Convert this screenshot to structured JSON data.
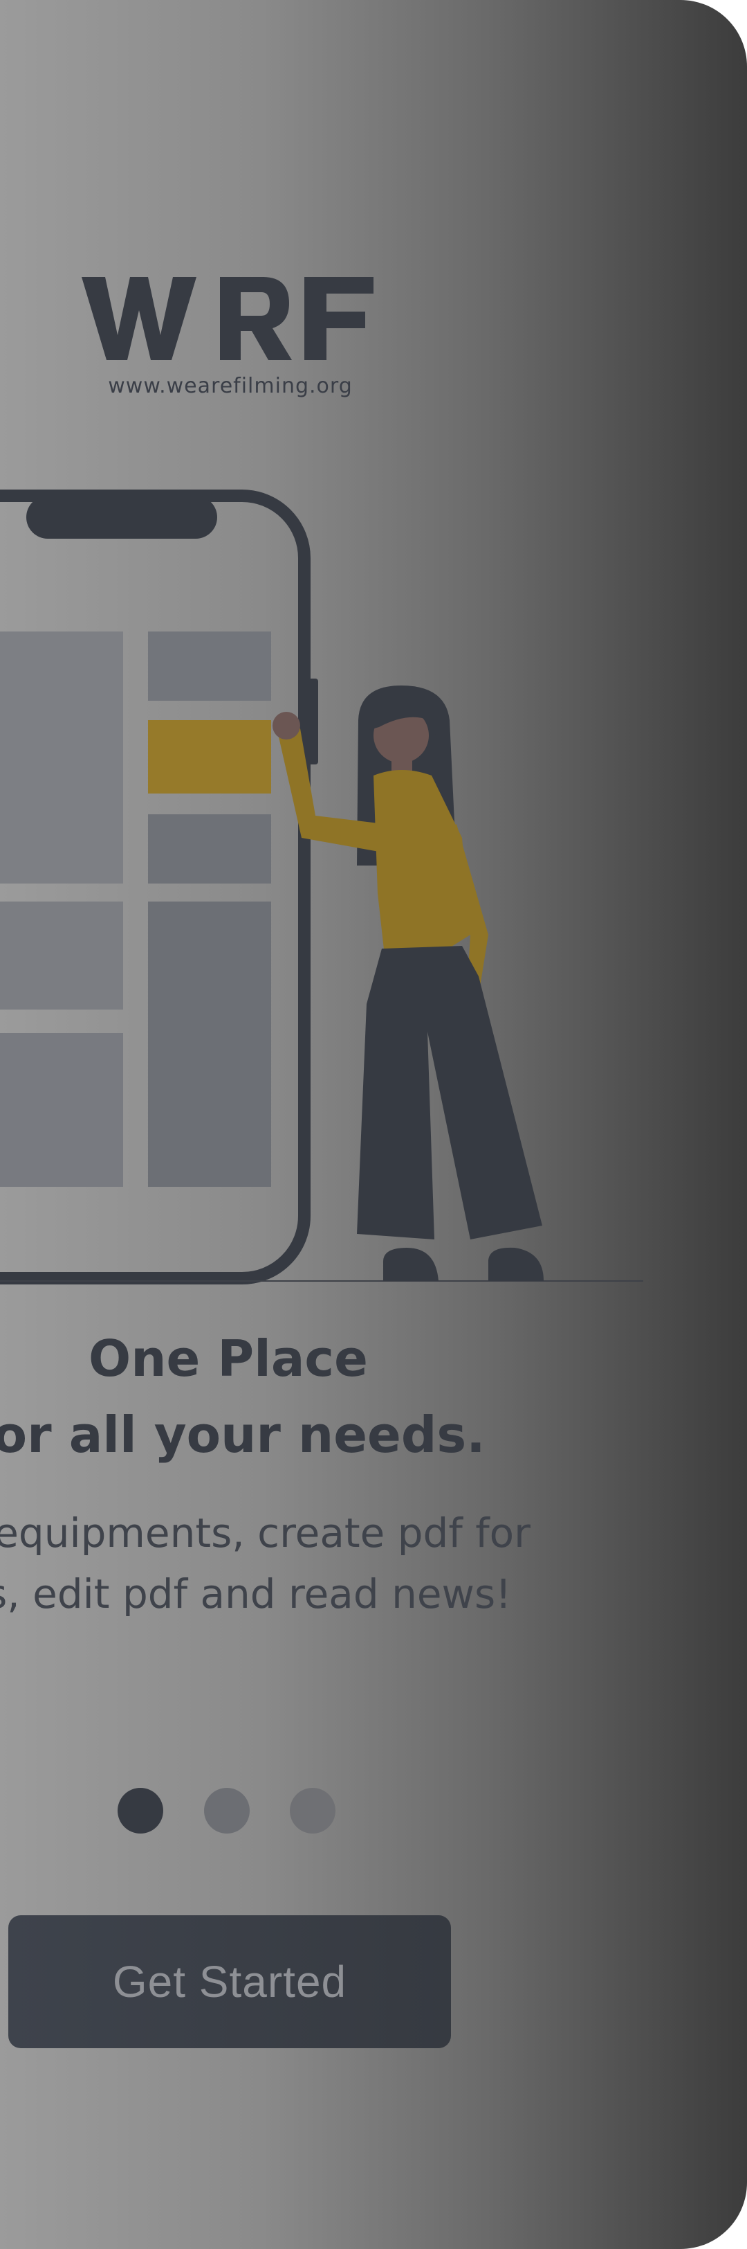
{
  "logo": {
    "wordmark": "WRF",
    "url": "www.wearefilming.org"
  },
  "illustration": {
    "name": "woman-with-phone-illustration"
  },
  "onboarding": {
    "title_line1": "One Place",
    "title_line2": "for all your needs.",
    "description": "for equipments, create pdf for ers, edit pdf and read news!",
    "description_line1": "for equipments, create pdf for",
    "description_line2": "ers, edit pdf and read news!",
    "page_indicator": {
      "current": 1,
      "total": 3
    }
  },
  "cta": {
    "label": "Get Started"
  },
  "colors": {
    "accent": "#967a2a",
    "dark": "#363a42",
    "panel_gray": "#6e7177"
  }
}
